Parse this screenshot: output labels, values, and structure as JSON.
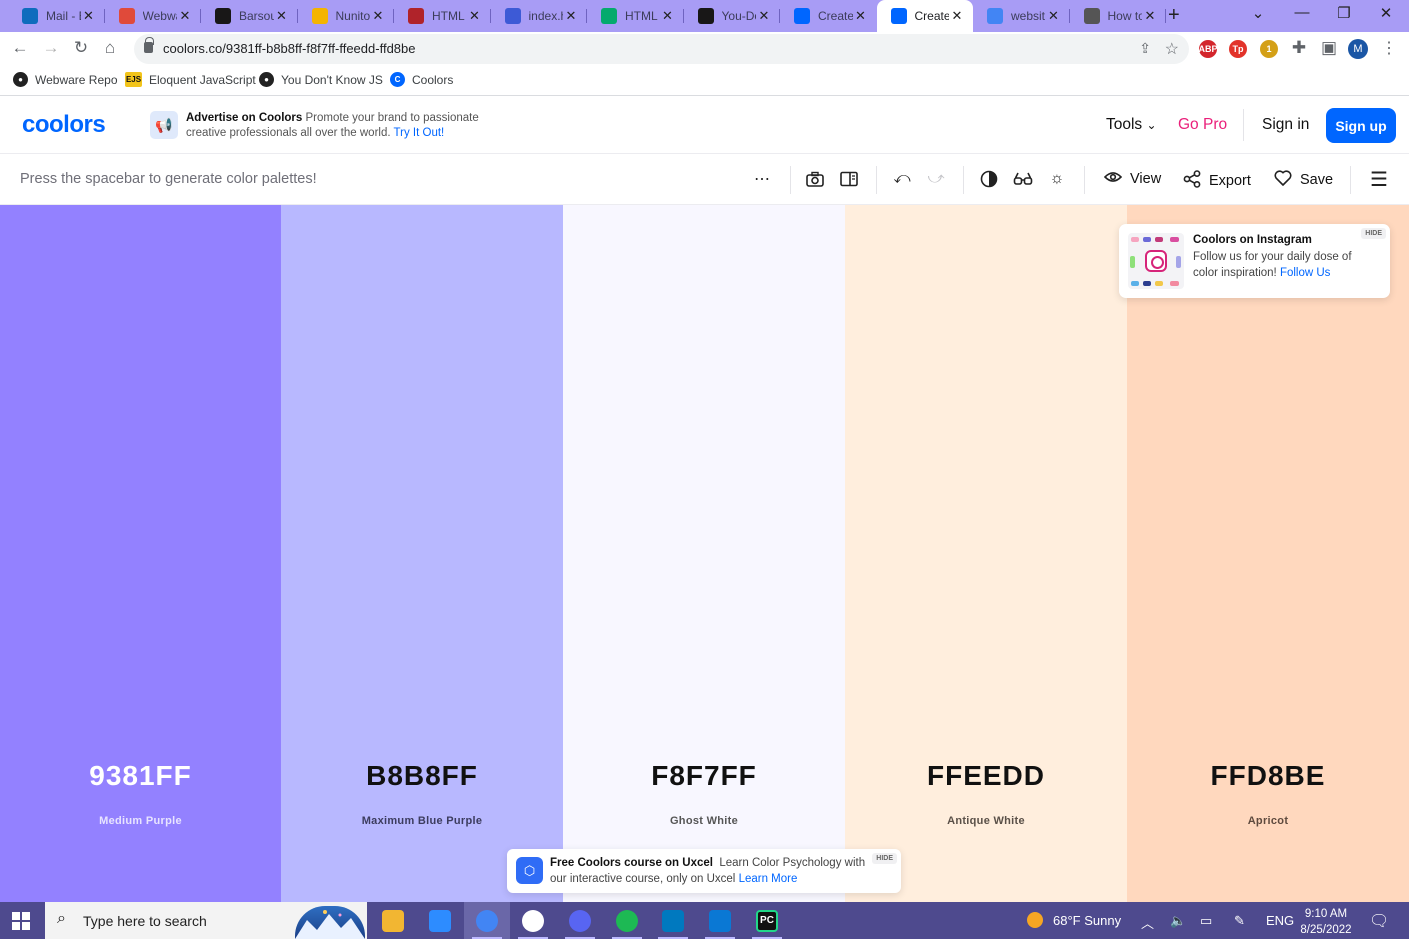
{
  "browser": {
    "tabs": [
      {
        "title": "Mail - E",
        "icon": "outlook-icon",
        "color": "#0f6cbd",
        "active": false
      },
      {
        "title": "Webwa",
        "icon": "webware-icon",
        "color": "#e04a3a",
        "active": false
      },
      {
        "title": "Barsou",
        "icon": "github-icon",
        "color": "#181717",
        "active": false
      },
      {
        "title": "Nunito",
        "icon": "google-fonts-icon",
        "color": "#f4b400",
        "active": false
      },
      {
        "title": "HTML",
        "icon": "w-icon",
        "color": "#b0232a",
        "active": false
      },
      {
        "title": "index.h",
        "icon": "flag-icon",
        "color": "#3d5ad6",
        "active": false
      },
      {
        "title": "HTML",
        "icon": "w3-icon",
        "color": "#04aa6d",
        "active": false
      },
      {
        "title": "You-Do",
        "icon": "github-icon",
        "color": "#181717",
        "active": false
      },
      {
        "title": "Create",
        "icon": "coolors-icon",
        "color": "#0066ff",
        "active": false
      },
      {
        "title": "Create",
        "icon": "coolors-icon",
        "color": "#0066ff",
        "active": true
      },
      {
        "title": "websit",
        "icon": "google-icon",
        "color": "#4285f4",
        "active": false
      },
      {
        "title": "How to",
        "icon": "globe-icon",
        "color": "#555555",
        "active": false
      }
    ],
    "url": "coolors.co/9381ff-b8b8ff-f8f7ff-ffeedd-ffd8be",
    "extensions": [
      {
        "name": "adblock-icon",
        "label": "ABP",
        "color": "#d3262c"
      },
      {
        "name": "tp-icon",
        "label": "Tp",
        "color": "#e2332a"
      },
      {
        "name": "shield-extension-icon",
        "label": "1",
        "color": "#d4a017"
      }
    ],
    "profile_initial": "M",
    "bookmarks": [
      {
        "label": "Webware Repo",
        "icon": "github-icon"
      },
      {
        "label": "Eloquent JavaScript",
        "icon": "ejs-icon",
        "badge": "EJS"
      },
      {
        "label": "You Don't Know JS",
        "icon": "github-icon"
      },
      {
        "label": "Coolors",
        "icon": "coolors-icon"
      }
    ]
  },
  "site": {
    "logo": "coolors",
    "ad": {
      "title": "Advertise on Coolors",
      "text": "Promote your brand to passionate creative professionals all over the world.",
      "link": "Try It Out!"
    },
    "nav": {
      "tools": "Tools",
      "go_pro": "Go Pro",
      "sign_in": "Sign in",
      "sign_up": "Sign up"
    },
    "generator": {
      "hint": "Press the spacebar to generate color palettes!",
      "view": "View",
      "export": "Export",
      "save": "Save"
    }
  },
  "palette": [
    {
      "hex": "9381FF",
      "name": "Medium Purple",
      "bg": "#9381ff",
      "fg": "#ffffff",
      "sub": "#e8e4ff"
    },
    {
      "hex": "B8B8FF",
      "name": "Maximum Blue Purple",
      "bg": "#b8b8ff",
      "fg": "#111111",
      "sub": "#3c3c5e"
    },
    {
      "hex": "F8F7FF",
      "name": "Ghost White",
      "bg": "#f8f7ff",
      "fg": "#111111",
      "sub": "#555555"
    },
    {
      "hex": "FFEEDD",
      "name": "Antique White",
      "bg": "#ffeedd",
      "fg": "#111111",
      "sub": "#5a5048"
    },
    {
      "hex": "FFD8BE",
      "name": "Apricot",
      "bg": "#ffd8be",
      "fg": "#111111",
      "sub": "#5e4a3e"
    }
  ],
  "instagram_card": {
    "title": "Coolors on Instagram",
    "text": "Follow us for your daily dose of color inspiration!",
    "link": "Follow Us",
    "hide": "HIDE"
  },
  "uxcel_banner": {
    "title": "Free Coolors course on Uxcel",
    "text": "Learn Color Psychology with our interactive course, only on Uxcel",
    "link": "Learn More",
    "hide": "HIDE"
  },
  "taskbar": {
    "search_placeholder": "Type here to search",
    "apps": [
      {
        "name": "file-explorer-icon",
        "color": "#f2b632",
        "label": ""
      },
      {
        "name": "zoom-icon",
        "color": "#2d8cff",
        "label": ""
      },
      {
        "name": "chrome-icon",
        "color": "#4285f4",
        "label": ""
      },
      {
        "name": "slack-icon",
        "color": "#ffffff",
        "label": ""
      },
      {
        "name": "discord-icon",
        "color": "#5865f2",
        "label": ""
      },
      {
        "name": "spotify-icon",
        "color": "#1db954",
        "label": ""
      },
      {
        "name": "trello-icon",
        "color": "#0079bf",
        "label": ""
      },
      {
        "name": "vscode-icon",
        "color": "#0a78d4",
        "label": ""
      },
      {
        "name": "pycharm-icon",
        "color": "#111111",
        "label": "PC"
      }
    ],
    "weather": "68°F  Sunny",
    "language": "ENG",
    "time": "9:10 AM",
    "date": "8/25/2022"
  }
}
